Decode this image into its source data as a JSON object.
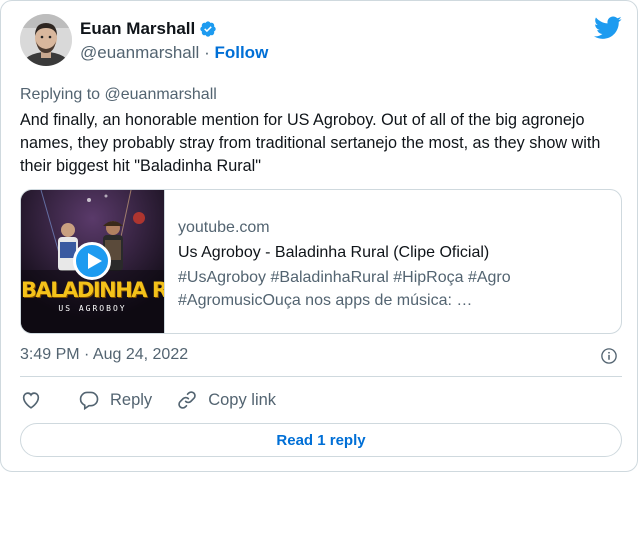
{
  "author": {
    "name": "Euan Marshall",
    "handle": "@euanmarshall",
    "separator": "·",
    "follow_label": "Follow"
  },
  "reply_context": {
    "prefix": "Replying to ",
    "mention": "@euanmarshall"
  },
  "tweet": {
    "text": "And finally, an honorable mention for US Agroboy. Out of all of the big agronejo names, they probably stray from traditional sertanejo the most, as they show with their biggest hit \"Baladinha Rural\""
  },
  "link_card": {
    "domain": "youtube.com",
    "title": "Us Agroboy - Baladinha Rural (Clipe Oficial)",
    "description_line1": "#UsAgroboy #BaladinhaRural #HipRoça #Agro",
    "description_line2": "#AgromusicOuça nos apps de música: …",
    "thumbnail_title": "BALADINHA RURAL",
    "thumbnail_subtitle": "US AGROBOY"
  },
  "timestamp": "3:49 PM · Aug 24, 2022",
  "actions": {
    "reply_label": "Reply",
    "copy_label": "Copy link"
  },
  "read_replies_label": "Read 1 reply",
  "icons": {
    "verified": "verified-badge-icon",
    "brand": "twitter-bird-icon",
    "like": "heart-icon",
    "reply": "speech-bubble-icon",
    "copy": "link-icon",
    "info": "info-icon",
    "play": "play-icon"
  },
  "colors": {
    "brand_blue": "#1d9bf0",
    "link_blue": "#006fd6",
    "text_primary": "#0f1419",
    "text_secondary": "#536471",
    "border": "#cfd9de"
  }
}
